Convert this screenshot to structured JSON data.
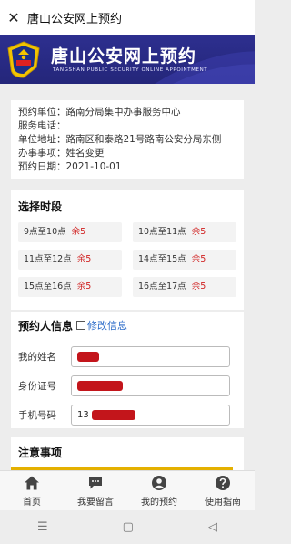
{
  "app_bar": {
    "close_glyph": "✕",
    "title": "唐山公安网上预约"
  },
  "banner": {
    "title": "唐山公安网上预约",
    "subtitle": "TANGSHAN PUBLIC SECURITY ONLINE APPOINTMENT"
  },
  "info": {
    "rows": [
      "预约单位：路南分局集中办事服务中心",
      "服务电话：",
      "单位地址：路南区和泰路21号路南公安分局东侧",
      "办事事项：姓名变更",
      "预约日期：2021-10-01"
    ]
  },
  "slots": {
    "header": "选择时段",
    "items": [
      {
        "time": "9点至10点",
        "remain": "余5"
      },
      {
        "time": "10点至11点",
        "remain": "余5"
      },
      {
        "time": "11点至12点",
        "remain": "余5"
      },
      {
        "time": "14点至15点",
        "remain": "余5"
      },
      {
        "time": "15点至16点",
        "remain": "余5"
      },
      {
        "time": "16点至17点",
        "remain": "余5"
      }
    ]
  },
  "applicant": {
    "header": "预约人信息",
    "modify_label": "修改信息",
    "fields": [
      {
        "label": "我的姓名",
        "value": ""
      },
      {
        "label": "身份证号",
        "value": ""
      },
      {
        "label": "手机号码",
        "value": "13"
      }
    ]
  },
  "notice": {
    "header": "注意事项"
  },
  "tabs": [
    {
      "label": "首页",
      "icon": "home-icon"
    },
    {
      "label": "我要留言",
      "icon": "chat-icon"
    },
    {
      "label": "我的预约",
      "icon": "user-icon"
    },
    {
      "label": "使用指南",
      "icon": "help-icon"
    }
  ],
  "colors": {
    "banner": "#2d2f8f",
    "remain": "#d02020",
    "link": "#2a6ac8",
    "redaction": "#c3151b"
  }
}
